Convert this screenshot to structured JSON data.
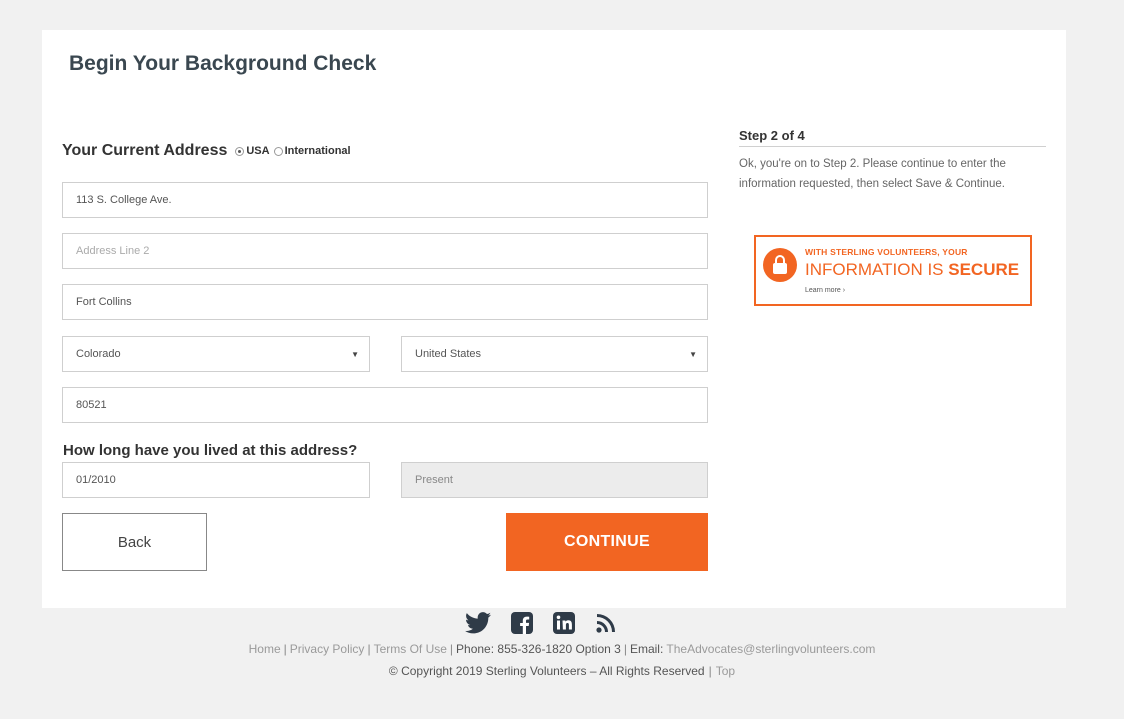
{
  "page": {
    "title": "Begin Your Background Check"
  },
  "address": {
    "heading": "Your Current Address",
    "radio_usa": "USA",
    "radio_international": "International",
    "line1_value": "113 S. College Ave.",
    "line2_placeholder": "Address Line 2",
    "city_value": "Fort Collins",
    "state_value": "Colorado",
    "country_value": "United States",
    "zip_value": "80521"
  },
  "duration": {
    "question": "How long have you lived at this address?",
    "from_value": "01/2010",
    "to_value": "Present"
  },
  "buttons": {
    "back": "Back",
    "continue": "CONTINUE"
  },
  "sidebar": {
    "step_title": "Step 2 of 4",
    "step_text": "Ok, you're on to Step 2. Please continue to enter the information requested, then select Save & Continue.",
    "secure_line1": "WITH STERLING VOLUNTEERS, YOUR",
    "secure_line2a": "INFORMATION IS ",
    "secure_line2b": "SECURE",
    "secure_learn": "Learn more ›"
  },
  "social": {
    "icons": [
      "twitter-icon",
      "facebook-icon",
      "linkedin-icon",
      "rss-icon"
    ]
  },
  "footer": {
    "home": "Home",
    "privacy": "Privacy Policy",
    "terms": "Terms Of Use",
    "phone": "Phone: 855-326-1820 Option 3",
    "email_label": "Email: ",
    "email": "TheAdvocates@sterlingvolunteers.com",
    "copyright": "© Copyright 2019 Sterling Volunteers – All Rights Reserved",
    "top": "Top"
  },
  "colors": {
    "accent": "#f26522",
    "background": "#f1f1f1"
  }
}
